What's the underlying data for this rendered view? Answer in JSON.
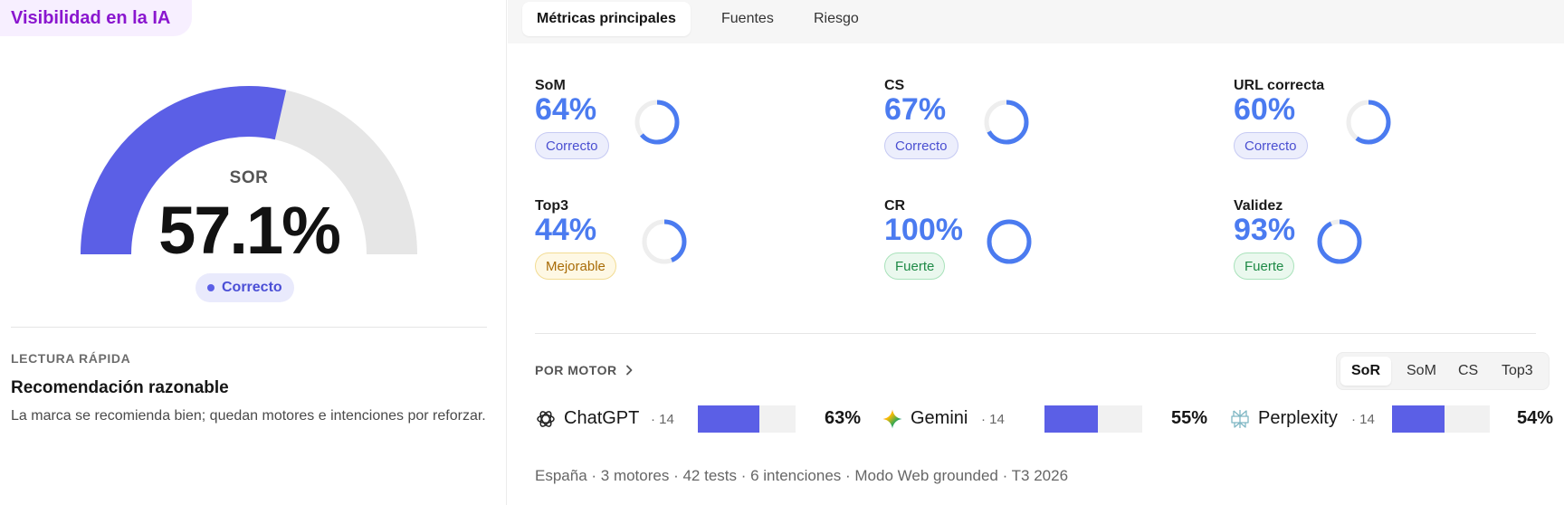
{
  "panel": {
    "title": "Visibilidad en la IA",
    "gauge": {
      "label": "SOR",
      "value_text": "57.1%",
      "value_fraction": 0.571,
      "badge": "Correcto"
    },
    "quick": {
      "kicker": "LECTURA RÁPIDA",
      "title": "Recomendación razonable",
      "text": "La marca se recomienda bien; quedan motores e intenciones por reforzar."
    }
  },
  "tabs": [
    {
      "label": "Métricas principales",
      "active": true
    },
    {
      "label": "Fuentes",
      "active": false
    },
    {
      "label": "Riesgo",
      "active": false
    }
  ],
  "metrics": [
    {
      "label": "SoM",
      "value": "64%",
      "fraction": 0.64,
      "badge": "Correcto",
      "status": "blue"
    },
    {
      "label": "CS",
      "value": "67%",
      "fraction": 0.67,
      "badge": "Correcto",
      "status": "blue"
    },
    {
      "label": "URL correcta",
      "value": "60%",
      "fraction": 0.6,
      "badge": "Correcto",
      "status": "blue"
    },
    {
      "label": "Top3",
      "value": "44%",
      "fraction": 0.44,
      "badge": "Mejorable",
      "status": "amber"
    },
    {
      "label": "CR",
      "value": "100%",
      "fraction": 1.0,
      "badge": "Fuerte",
      "status": "green"
    },
    {
      "label": "Validez",
      "value": "93%",
      "fraction": 0.93,
      "badge": "Fuerte",
      "status": "green"
    }
  ],
  "by_engine": {
    "heading": "POR MOTOR",
    "toggle": [
      "SoR",
      "SoM",
      "CS",
      "Top3"
    ],
    "toggle_active": "SoR",
    "engines": [
      {
        "name": "ChatGPT",
        "count": "· 14",
        "pct_text": "63%",
        "fraction": 0.63,
        "icon": "chatgpt-icon"
      },
      {
        "name": "Gemini",
        "count": "· 14",
        "pct_text": "55%",
        "fraction": 0.55,
        "icon": "gemini-icon"
      },
      {
        "name": "Perplexity",
        "count": "· 14",
        "pct_text": "54%",
        "fraction": 0.54,
        "icon": "perplexity-icon"
      }
    ]
  },
  "footer": "España · 3 motores · 42 tests · 6 intenciones · Modo Web grounded · T3 2026",
  "colors": {
    "accent": "#5b5fe6",
    "metric_blue": "#4b7bf0",
    "title_purple": "#8a16cf",
    "track": "#e6e6e6"
  }
}
